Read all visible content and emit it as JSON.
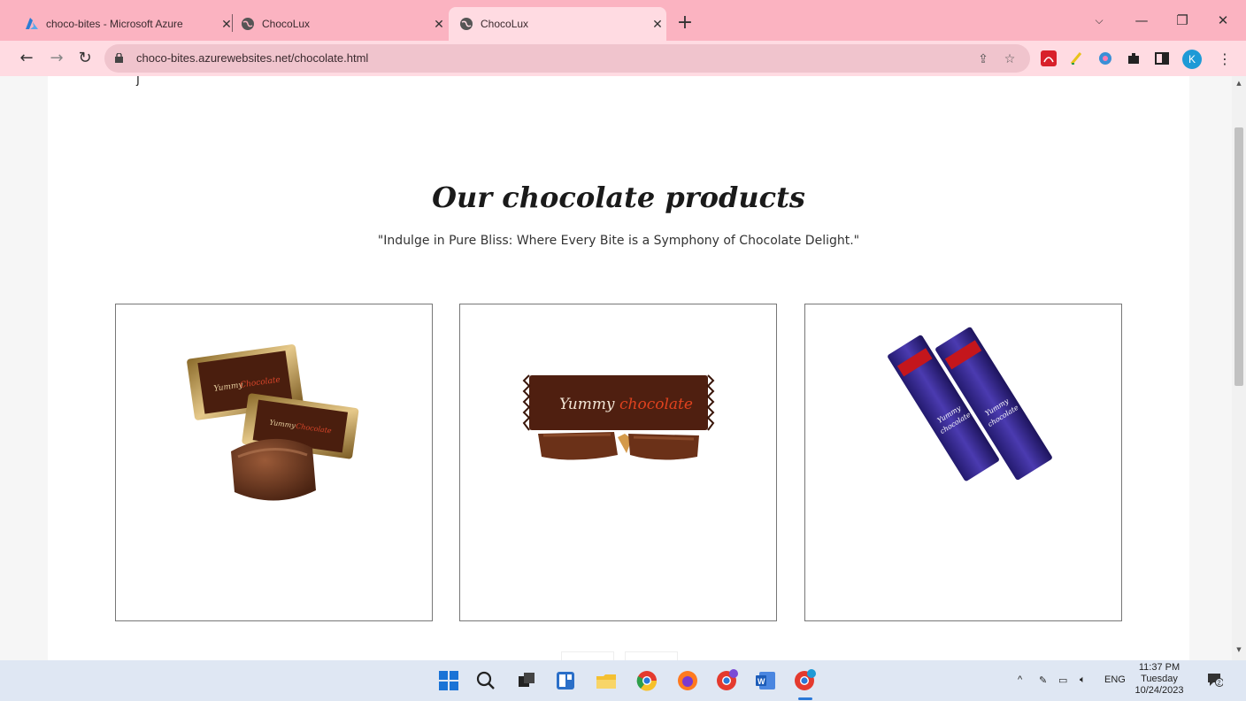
{
  "browser": {
    "tabs": [
      {
        "title": "choco-bites - Microsoft Azure",
        "icon": "azure-icon",
        "active": false
      },
      {
        "title": "ChocoLux",
        "icon": "globe-icon",
        "active": false
      },
      {
        "title": "ChocoLux",
        "icon": "globe-icon",
        "active": true
      }
    ],
    "new_tab_label": "+",
    "url": "choco-bites.azurewebsites.net/chocolate.html",
    "profile_initial": "K",
    "colors": {
      "tabstrip": "#fbb3c1",
      "toolbar": "#ffdbe2",
      "omnibox": "#f0c4cd"
    }
  },
  "page": {
    "heading": "Our chocolate products",
    "subtitle": "\"Indulge in Pure Bliss: Where Every Bite is a Symphony of Chocolate Delight.\"",
    "products": [
      {
        "image": "wrapped-toffee-chocolates",
        "wrapper_text": "Yummy",
        "wrapper_text_accent": "Chocolate"
      },
      {
        "image": "chocolate-bar",
        "wrapper_text": "Yummy",
        "wrapper_text_accent": "chocolate"
      },
      {
        "image": "purple-chocolate-bars",
        "wrapper_text": "Yummy",
        "wrapper_text_accent": "chocolate"
      }
    ]
  },
  "taskbar": {
    "tray_language": "ENG",
    "time": "11:37 PM",
    "day": "Tuesday",
    "date": "10/24/2023",
    "notification_count": "2"
  }
}
